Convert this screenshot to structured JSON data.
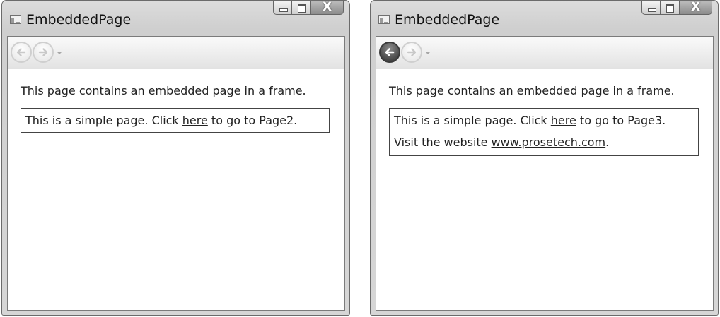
{
  "windows": [
    {
      "title": "EmbeddedPage",
      "caption_buttons": {
        "close_glyph": "X"
      },
      "nav": {
        "back_enabled": false,
        "forward_enabled": false
      },
      "intro_text": "This page contains an embedded page in a frame.",
      "frame": {
        "line1_prefix": "This is a simple page. Click ",
        "line1_link": "here",
        "line1_suffix": " to go to Page2."
      }
    },
    {
      "title": "EmbeddedPage",
      "caption_buttons": {
        "close_glyph": "X"
      },
      "nav": {
        "back_enabled": true,
        "forward_enabled": false
      },
      "intro_text": "This page contains an embedded page in a frame.",
      "frame": {
        "line1_prefix": "This is a simple page. Click ",
        "line1_link": "here",
        "line1_suffix": " to go to Page3.",
        "line2_prefix": "Visit the website ",
        "line2_link": "www.prosetech.com",
        "line2_suffix": "."
      }
    }
  ]
}
